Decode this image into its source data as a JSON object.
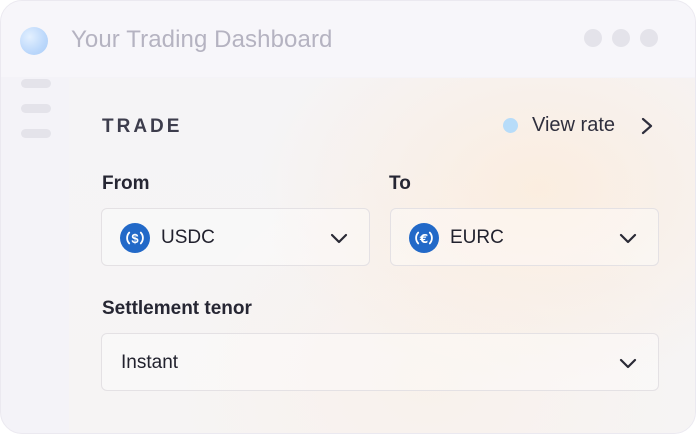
{
  "window": {
    "title": "Your Trading Dashboard"
  },
  "trade": {
    "heading": "TRADE",
    "view_rate_label": "View rate",
    "from_label": "From",
    "from_value": "USDC",
    "to_label": "To",
    "to_value": "EURC",
    "tenor_label": "Settlement tenor",
    "tenor_value": "Instant"
  },
  "colors": {
    "coin_blue": "#2269c8",
    "rate_dot": "#b7dcf9"
  },
  "icons": {
    "from_coin": "usdc-coin-icon",
    "to_coin": "eurc-coin-icon",
    "chevron": "chevron-down-icon",
    "rate_arrow": "chevron-right-icon"
  }
}
